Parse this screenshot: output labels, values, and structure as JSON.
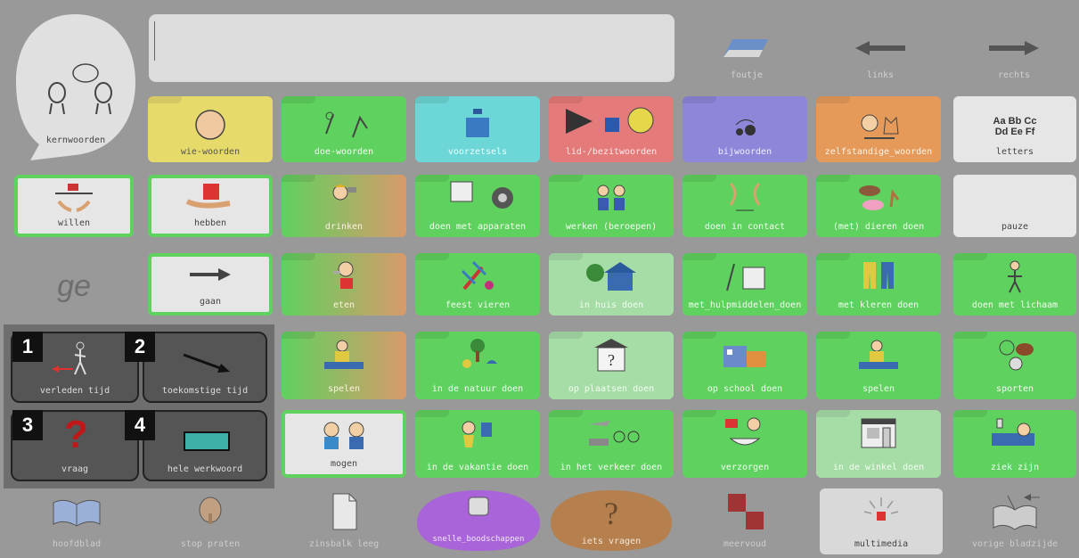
{
  "header": {
    "kernwoorden": "kernwoorden",
    "sentence_bar": "",
    "foutje": "foutje",
    "links": "links",
    "rechts": "rechts"
  },
  "categories": {
    "wie": "wie-woorden",
    "doe": "doe-woorden",
    "voorzetsels": "voorzetsels",
    "lid": "lid-/bezitwoorden",
    "bijwoorden": "bijwoorden",
    "zelfstandige": "zelfstandige_woorden",
    "letters_label": "letters",
    "letters_line1": "Aa Bb Cc",
    "letters_line2": "Dd Ee Ff"
  },
  "row2": {
    "willen": "willen",
    "hebben": "hebben",
    "drinken": "drinken",
    "apparaten": "doen met apparaten",
    "werken": "werken (beroepen)",
    "contact": "doen in contact",
    "dieren": "(met) dieren doen",
    "pauze": "pauze"
  },
  "row3": {
    "ge": "ge",
    "gaan": "gaan",
    "eten": "eten",
    "feest": "feest vieren",
    "huis": "in huis doen",
    "hulpmiddelen": "met_hulpmiddelen_doen",
    "kleren": "met kleren doen",
    "lichaam": "doen met lichaam"
  },
  "row4": {
    "verleden": "verleden tijd",
    "toekomstig": "toekomstige tijd",
    "spelen1": "spelen",
    "natuur": "in de natuur doen",
    "plaatsen": "op plaatsen doen",
    "school": "op school doen",
    "spelen2": "spelen",
    "sporten": "sporten"
  },
  "row5": {
    "vraag": "vraag",
    "werkwoord": "hele werkwoord",
    "mogen": "mogen",
    "vakantie": "in de vakantie doen",
    "verkeer": "in het verkeer doen",
    "verzorgen": "verzorgen",
    "winkel": "in de winkel doen",
    "ziek": "ziek zijn"
  },
  "bottom": {
    "hoofdblad": "hoofdblad",
    "stop": "stop praten",
    "zinsbalk": "zinsbalk leeg",
    "snelle": "snelle_boodschappen",
    "iets": "iets vragen",
    "meervoud": "meervoud",
    "multimedia": "multimedia",
    "vorige": "vorige bladzijde"
  },
  "badges": [
    "1",
    "2",
    "3",
    "4"
  ]
}
